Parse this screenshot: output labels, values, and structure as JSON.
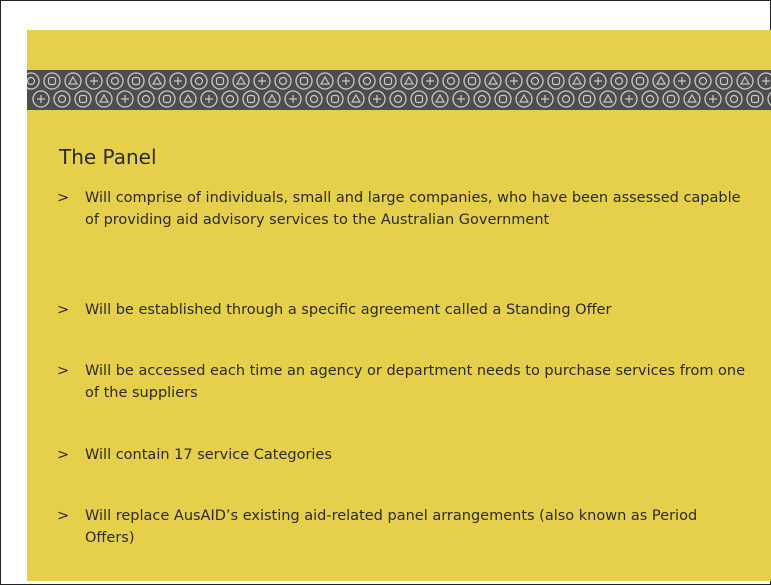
{
  "slide": {
    "title": "The Panel",
    "bullet_marker": ">",
    "bullets": [
      "Will comprise of individuals, small and large companies, who have been assessed capable of providing aid advisory services to the Australian Government",
      "Will be established through a specific agreement called a Standing Offer",
      "Will be accessed each time an agency or department needs to purchase services from one of the suppliers",
      "Will contain 17 service Categories",
      "Will replace AusAID’s existing aid-related panel arrangements (also known as Period Offers)"
    ]
  },
  "colors": {
    "background": "#e6cf4b",
    "band": "#4d4d4d",
    "icon_line": "#c9c9c9",
    "text": "#2b2b2b"
  }
}
